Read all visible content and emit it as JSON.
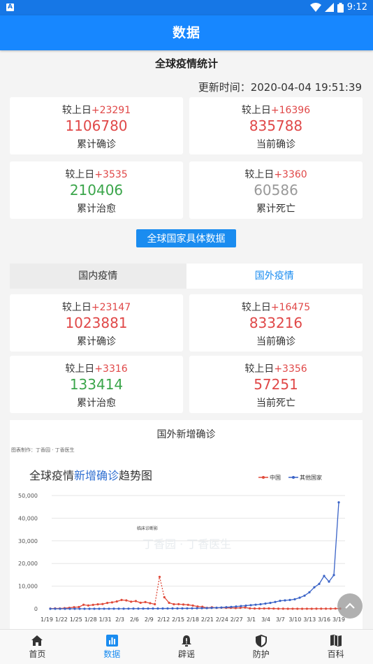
{
  "status": {
    "time": "9:12",
    "badge": "A"
  },
  "appbar": {
    "title": "数据"
  },
  "global": {
    "title": "全球疫情统计",
    "update_time": "更新时间：2020-04-04 19:51:39",
    "delta_prefix": "较上日",
    "cards": [
      {
        "delta": "+23291",
        "value": "1106780",
        "label": "累计确诊",
        "color": "#e04848"
      },
      {
        "delta": "+16396",
        "value": "835788",
        "label": "当前确诊",
        "color": "#e04848"
      },
      {
        "delta": "+3535",
        "value": "210406",
        "label": "累计治愈",
        "color": "#3aa54a"
      },
      {
        "delta": "+3360",
        "value": "60586",
        "label": "累计死亡",
        "color": "#999999"
      }
    ]
  },
  "detail_button": "全球国家具体数据",
  "tabs": [
    {
      "label": "国内疫情",
      "active": false
    },
    {
      "label": "国外疫情",
      "active": true
    }
  ],
  "foreign": {
    "delta_prefix": "较上日",
    "cards": [
      {
        "delta": "+23147",
        "value": "1023881",
        "label": "累计确诊",
        "color": "#e04848"
      },
      {
        "delta": "+16475",
        "value": "833216",
        "label": "当前确诊",
        "color": "#e04848"
      },
      {
        "delta": "+3316",
        "value": "133414",
        "label": "累计治愈",
        "color": "#3aa54a"
      },
      {
        "delta": "+3356",
        "value": "57251",
        "label": "当前死亡",
        "color": "#e04848"
      }
    ]
  },
  "chart_card": {
    "title": "国外新增确诊",
    "credit": "图表制作：丁香园 · 丁香医生",
    "trend_title_a": "全球疫情",
    "trend_title_hl": "新增确诊",
    "trend_title_b": "趋势图",
    "annotation": "临床诊断影",
    "watermark": "丁香园 · 丁香医生"
  },
  "chart_data": {
    "type": "line",
    "ylim": [
      0,
      50000
    ],
    "yticks": [
      "0",
      "10,000",
      "20,000",
      "30,000",
      "40,000",
      "50,000"
    ],
    "xticks": [
      "1/19",
      "1/22",
      "1/25",
      "1/28",
      "1/31",
      "2/3",
      "2/6",
      "2/9",
      "2/12",
      "2/15",
      "2/18",
      "2/21",
      "2/24",
      "2/27",
      "3/1",
      "3/4",
      "3/7",
      "3/10",
      "3/13",
      "3/16",
      "3/19"
    ],
    "legend_position": "top-right",
    "grid": true,
    "series": [
      {
        "name": "中国",
        "color": "#e04a3a",
        "values": [
          77,
          149,
          131,
          259,
          444,
          688,
          769,
          1771,
          1459,
          1737,
          1981,
          2099,
          2590,
          2829,
          3235,
          3887,
          3694,
          3143,
          3385,
          2652,
          2973,
          2467,
          2015,
          14108,
          5090,
          2641,
          2008,
          2048,
          1886,
          1749,
          1432,
          1000,
          889,
          397,
          648,
          409,
          508,
          406,
          433,
          327,
          427,
          573,
          202,
          125,
          119,
          139,
          143,
          99,
          44,
          40,
          19,
          24,
          15,
          11,
          21,
          13,
          34,
          39,
          41,
          46,
          99,
          78
        ]
      },
      {
        "name": "其他国家",
        "color": "#3a63c7",
        "values": [
          0,
          0,
          0,
          1,
          2,
          4,
          6,
          8,
          10,
          12,
          15,
          20,
          25,
          30,
          40,
          50,
          60,
          70,
          80,
          90,
          100,
          110,
          120,
          130,
          140,
          150,
          160,
          170,
          180,
          200,
          230,
          260,
          300,
          380,
          460,
          560,
          700,
          830,
          1000,
          1200,
          1400,
          1600,
          1800,
          2000,
          2300,
          2600,
          3000,
          3500,
          3700,
          3900,
          4200,
          4900,
          5800,
          7300,
          9500,
          11000,
          14500,
          12000,
          14900,
          47000
        ]
      }
    ]
  },
  "bottom_nav": [
    {
      "label": "首页",
      "icon": "home-icon",
      "active": false
    },
    {
      "label": "数据",
      "icon": "chart-icon",
      "active": true
    },
    {
      "label": "辟谣",
      "icon": "alert-icon",
      "active": false
    },
    {
      "label": "防护",
      "icon": "shield-icon",
      "active": false
    },
    {
      "label": "百科",
      "icon": "book-icon",
      "active": false
    }
  ]
}
